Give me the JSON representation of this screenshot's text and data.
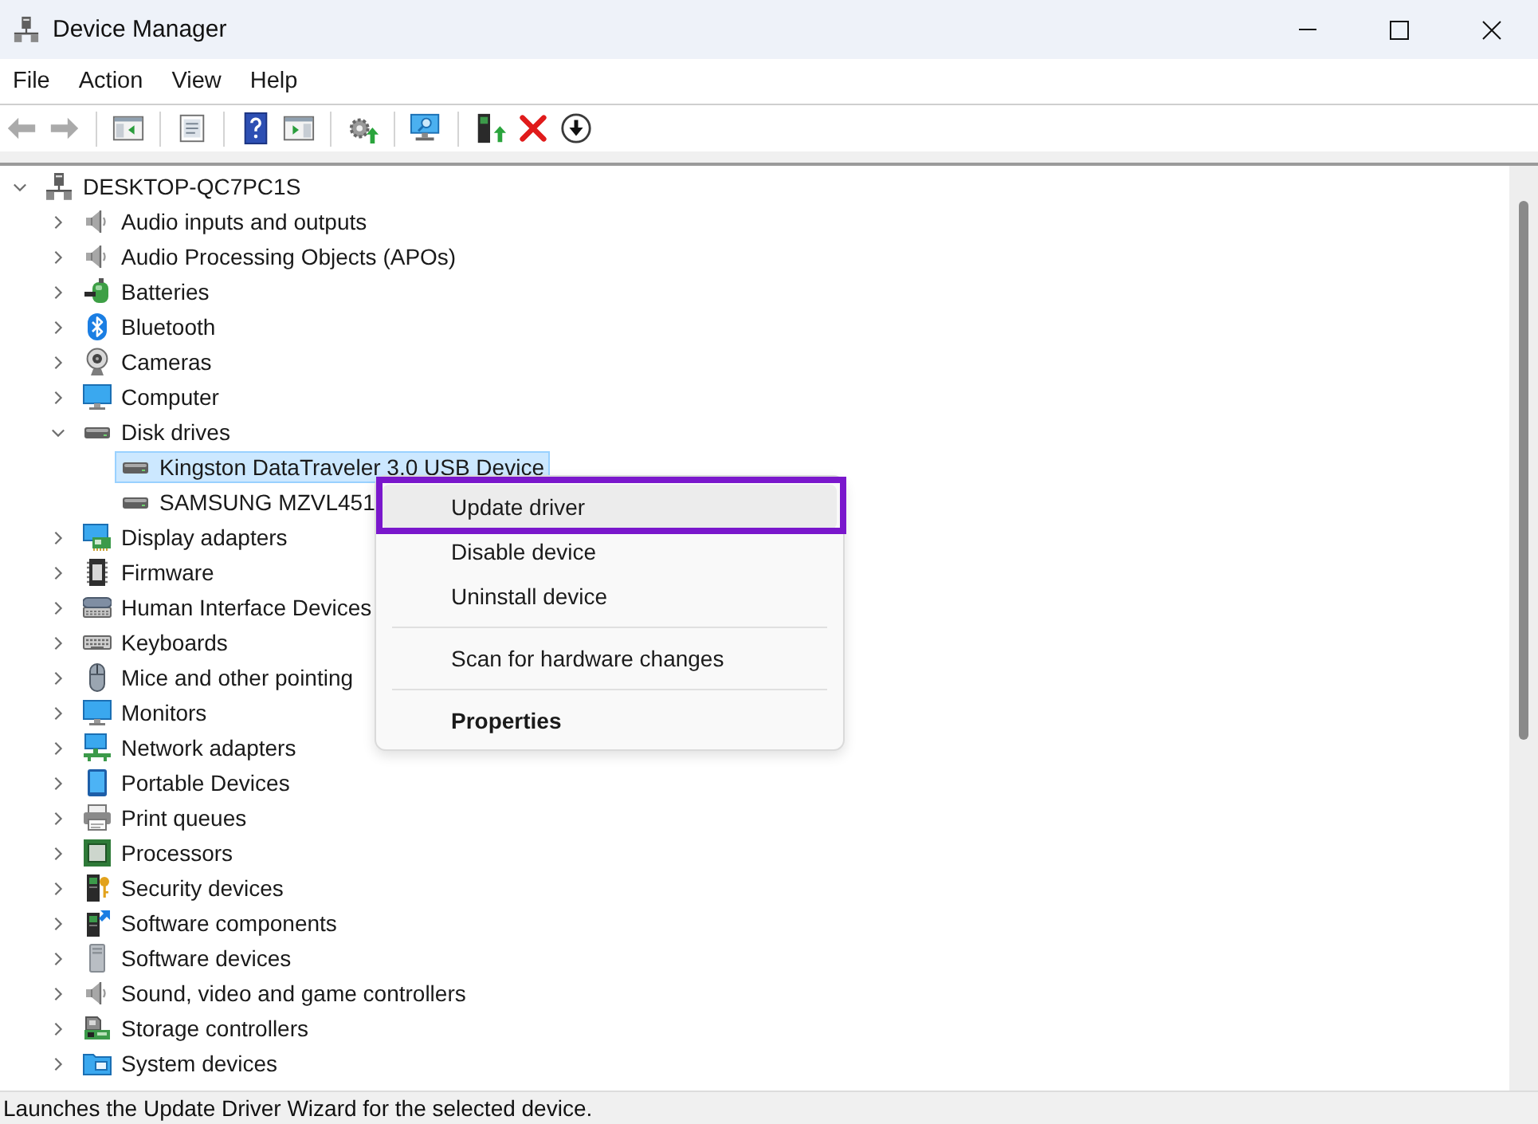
{
  "window": {
    "title": "Device Manager"
  },
  "menu_bar": {
    "items": [
      "File",
      "Action",
      "View",
      "Help"
    ]
  },
  "toolbar": {
    "buttons": [
      {
        "disabled": true
      },
      {
        "disabled": true
      },
      {
        "disabled": false
      },
      {
        "disabled": false
      },
      {
        "disabled": false
      },
      {
        "disabled": false
      },
      {
        "disabled": false
      },
      {
        "disabled": false
      },
      {
        "disabled": false
      },
      {
        "disabled": false
      },
      {
        "disabled": false
      }
    ]
  },
  "tree": {
    "root": {
      "label": "DESKTOP-QC7PC1S",
      "expanded": true,
      "selected": false,
      "children": [
        {
          "label": "Audio inputs and outputs",
          "expanded": false,
          "selected": false
        },
        {
          "label": "Audio Processing Objects (APOs)",
          "expanded": false,
          "selected": false
        },
        {
          "label": "Batteries",
          "expanded": false,
          "selected": false
        },
        {
          "label": "Bluetooth",
          "expanded": false,
          "selected": false
        },
        {
          "label": "Cameras",
          "expanded": false,
          "selected": false
        },
        {
          "label": "Computer",
          "expanded": false,
          "selected": false
        },
        {
          "label": "Disk drives",
          "expanded": true,
          "selected": false,
          "children": [
            {
              "label": "Kingston DataTraveler 3.0 USB Device",
              "selected": true
            },
            {
              "label": "SAMSUNG MZVL451",
              "selected": false
            }
          ]
        },
        {
          "label": "Display adapters",
          "expanded": false,
          "selected": false
        },
        {
          "label": "Firmware",
          "expanded": false,
          "selected": false
        },
        {
          "label": "Human Interface Devices",
          "expanded": false,
          "selected": false
        },
        {
          "label": "Keyboards",
          "expanded": false,
          "selected": false
        },
        {
          "label": "Mice and other pointing",
          "expanded": false,
          "selected": false
        },
        {
          "label": "Monitors",
          "expanded": false,
          "selected": false
        },
        {
          "label": "Network adapters",
          "expanded": false,
          "selected": false
        },
        {
          "label": "Portable Devices",
          "expanded": false,
          "selected": false
        },
        {
          "label": "Print queues",
          "expanded": false,
          "selected": false
        },
        {
          "label": "Processors",
          "expanded": false,
          "selected": false
        },
        {
          "label": "Security devices",
          "expanded": false,
          "selected": false
        },
        {
          "label": "Software components",
          "expanded": false,
          "selected": false
        },
        {
          "label": "Software devices",
          "expanded": false,
          "selected": false
        },
        {
          "label": "Sound, video and game controllers",
          "expanded": false,
          "selected": false
        },
        {
          "label": "Storage controllers",
          "expanded": false,
          "selected": false
        },
        {
          "label": "System devices",
          "expanded": false,
          "selected": false
        }
      ]
    }
  },
  "context_menu": {
    "items": [
      {
        "kind": "item",
        "label": "Update driver",
        "selected": true,
        "default": false,
        "highlighted": true
      },
      {
        "kind": "item",
        "label": "Disable device",
        "selected": false,
        "default": false,
        "highlighted": false
      },
      {
        "kind": "item",
        "label": "Uninstall device",
        "selected": false,
        "default": false,
        "highlighted": false
      },
      {
        "kind": "separator"
      },
      {
        "kind": "item",
        "label": "Scan for hardware changes",
        "selected": false,
        "default": false,
        "highlighted": false
      },
      {
        "kind": "separator"
      },
      {
        "kind": "item",
        "label": "Properties",
        "selected": false,
        "default": true,
        "highlighted": false
      }
    ]
  },
  "status_bar": {
    "text": "Launches the Update Driver Wizard for the selected device."
  }
}
